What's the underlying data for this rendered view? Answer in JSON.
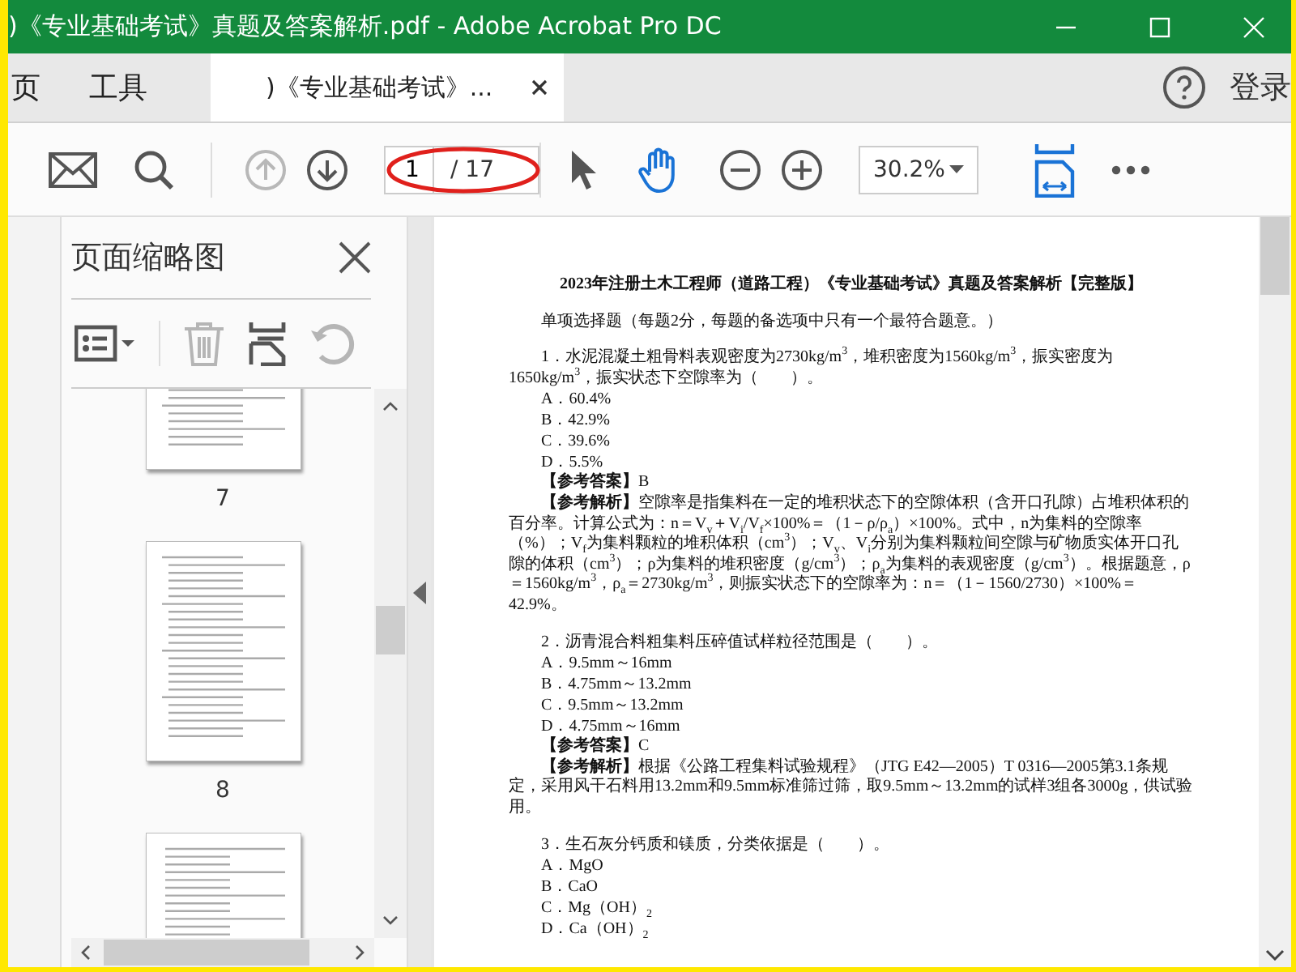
{
  "window": {
    "title": ")《专业基础考试》真题及答案解析.pdf - Adobe Acrobat Pro DC"
  },
  "nav_tabs": [
    {
      "label": "页",
      "selected": false
    },
    {
      "label": "工具",
      "selected": false
    }
  ],
  "document_tabs": [
    {
      "label": ")《专业基础考试》...",
      "selected": true
    }
  ],
  "account": {
    "label": "登录"
  },
  "toolbar": {
    "previous_page": {
      "disabled": true
    },
    "next_page": {
      "disabled": false
    },
    "page_number": "1",
    "page_total": "/ 17",
    "zoom": "30.2%",
    "tools": [
      {
        "kind": "select",
        "selected": false
      },
      {
        "kind": "hand",
        "selected": true
      }
    ]
  },
  "thumbnails_panel": {
    "title": "页面缩略图",
    "actions": [
      {
        "kind": "options",
        "disabled": false
      },
      {
        "kind": "delete",
        "disabled": true
      },
      {
        "kind": "extract",
        "disabled": false
      },
      {
        "kind": "rotate",
        "disabled": true
      }
    ],
    "pages": [
      {
        "label": "7"
      },
      {
        "label": "8"
      }
    ]
  },
  "document": {
    "paragraphs": [
      {
        "kind": "title",
        "text": "2023年注册土木工程师（道路工程）《专业基础考试》真题及答案解析【完整版】"
      },
      {
        "kind": "heading",
        "text": "单项选择题（每题2分，每题的备选项中只有一个最符合题意。）"
      },
      {
        "kind": "question",
        "text": "1．水泥混凝土粗骨料表观密度为2730kg/m$^{3}$，堆积密度为1560kg/m$^{3}$，振实密度为1650kg/m$^{3}$，振实状态下空隙率为（　　）。"
      },
      {
        "kind": "option",
        "text": "A．60.4%"
      },
      {
        "kind": "option",
        "text": "B．42.9%"
      },
      {
        "kind": "option",
        "text": "C．39.6%"
      },
      {
        "kind": "option",
        "text": "D．5.5%"
      },
      {
        "kind": "answer",
        "text": "**【参考答案】**B"
      },
      {
        "kind": "analysis",
        "text": "**【参考解析】**空隙率是指集料在一定的堆积状态下的空隙体积（含开口孔隙）占堆积体积的百分率。计算公式为：n＝V$_{v}$＋V$_{i}$/V$_{f}$×100%＝（1－ρ/ρ$_{a}$）×100%。式中，n为集料的空隙率（%）；V$_{f}$为集料颗粒的堆积体积（cm$^{3}$）；V$_{v}$、V$_{i}$分别为集料颗粒间空隙与矿物质实体开口孔隙的体积（cm$^{3}$）；ρ为集料的堆积密度（g/cm$^{3}$）；ρ$_{a}$为集料的表观密度（g/cm$^{3}$）。根据题意，ρ＝1560kg/m$^{3}$，ρ$_{a}$＝2730kg/m$^{3}$，则振实状态下的空隙率为：n＝（1－1560/2730）×100%＝42.9%。"
      },
      {
        "kind": "question",
        "text": "2．沥青混合料粗集料压碎值试样粒径范围是（　　）。"
      },
      {
        "kind": "option",
        "text": "A．9.5mm～16mm"
      },
      {
        "kind": "option",
        "text": "B．4.75mm～13.2mm"
      },
      {
        "kind": "option",
        "text": "C．9.5mm～13.2mm"
      },
      {
        "kind": "option",
        "text": "D．4.75mm～16mm"
      },
      {
        "kind": "answer",
        "text": "**【参考答案】**C"
      },
      {
        "kind": "analysis",
        "text": "**【参考解析】**根据《公路工程集料试验规程》（JTG E42—2005）T 0316—2005第3.1条规定，采用风干石料用13.2mm和9.5mm标准筛过筛，取9.5mm～13.2mm的试样3组各3000g，供试验用。"
      },
      {
        "kind": "question",
        "text": "3．生石灰分钙质和镁质，分类依据是（　　）。"
      },
      {
        "kind": "option",
        "text": "A．MgO"
      },
      {
        "kind": "option",
        "text": "B．CaO"
      },
      {
        "kind": "option",
        "text": "C．Mg（OH）$_{2}$"
      },
      {
        "kind": "option",
        "text": "D．Ca（OH）$_{2}$"
      }
    ]
  }
}
